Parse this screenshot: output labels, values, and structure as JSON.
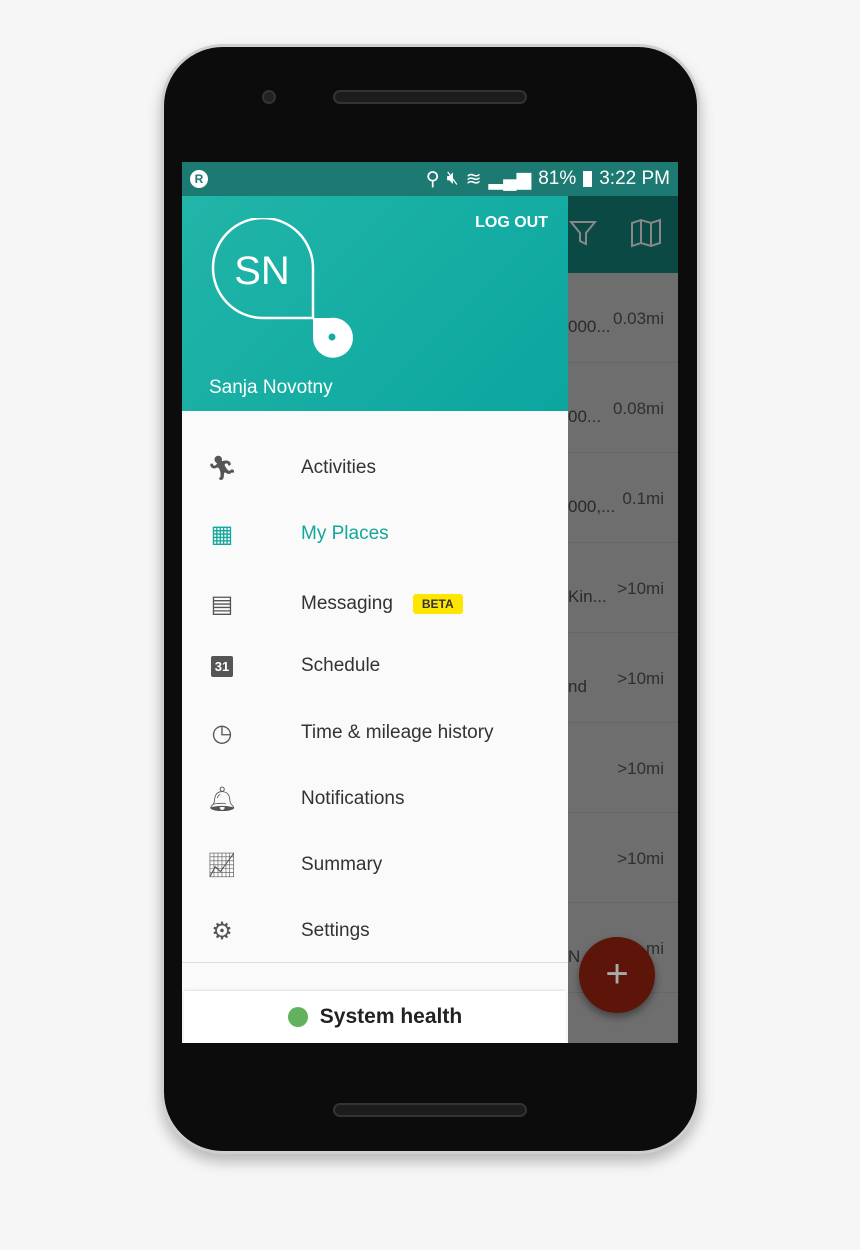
{
  "status": {
    "time": "3:22 PM",
    "battery": "81%",
    "app_badge": "R"
  },
  "profile": {
    "initials": "SN",
    "name": "Sanja Novotny",
    "logout": "LOG OUT"
  },
  "menu": [
    {
      "label": "Activities",
      "icon": "running-person-icon"
    },
    {
      "label": "My Places",
      "icon": "buildings-icon",
      "active": true
    },
    {
      "label": "Messaging",
      "icon": "chat-icon",
      "badge": "BETA"
    },
    {
      "label": "Schedule",
      "icon": "calendar-icon",
      "icon_text": "31"
    },
    {
      "label": "Time & mileage history",
      "icon": "clock-icon"
    },
    {
      "label": "Notifications",
      "icon": "bell-icon"
    },
    {
      "label": "Summary",
      "icon": "chart-icon"
    },
    {
      "label": "Settings",
      "icon": "gear-icon"
    }
  ],
  "system_health": {
    "label": "System health",
    "color": "#62b15e"
  },
  "background_list": [
    {
      "text": "000...",
      "distance": "0.03mi"
    },
    {
      "text": "00...",
      "distance": "0.08mi"
    },
    {
      "text": "000,...",
      "distance": "0.1mi"
    },
    {
      "text": "Kin...",
      "distance": ">10mi"
    },
    {
      "text": "nd",
      "distance": ">10mi"
    },
    {
      "text": "",
      "distance": ">10mi"
    },
    {
      "text": "",
      "distance": ">10mi"
    },
    {
      "text": "N",
      "distance": "mi"
    }
  ],
  "fab": "+",
  "colors": {
    "accent": "#13a69d",
    "fab": "#5c1508",
    "beta": "#ffe600"
  }
}
